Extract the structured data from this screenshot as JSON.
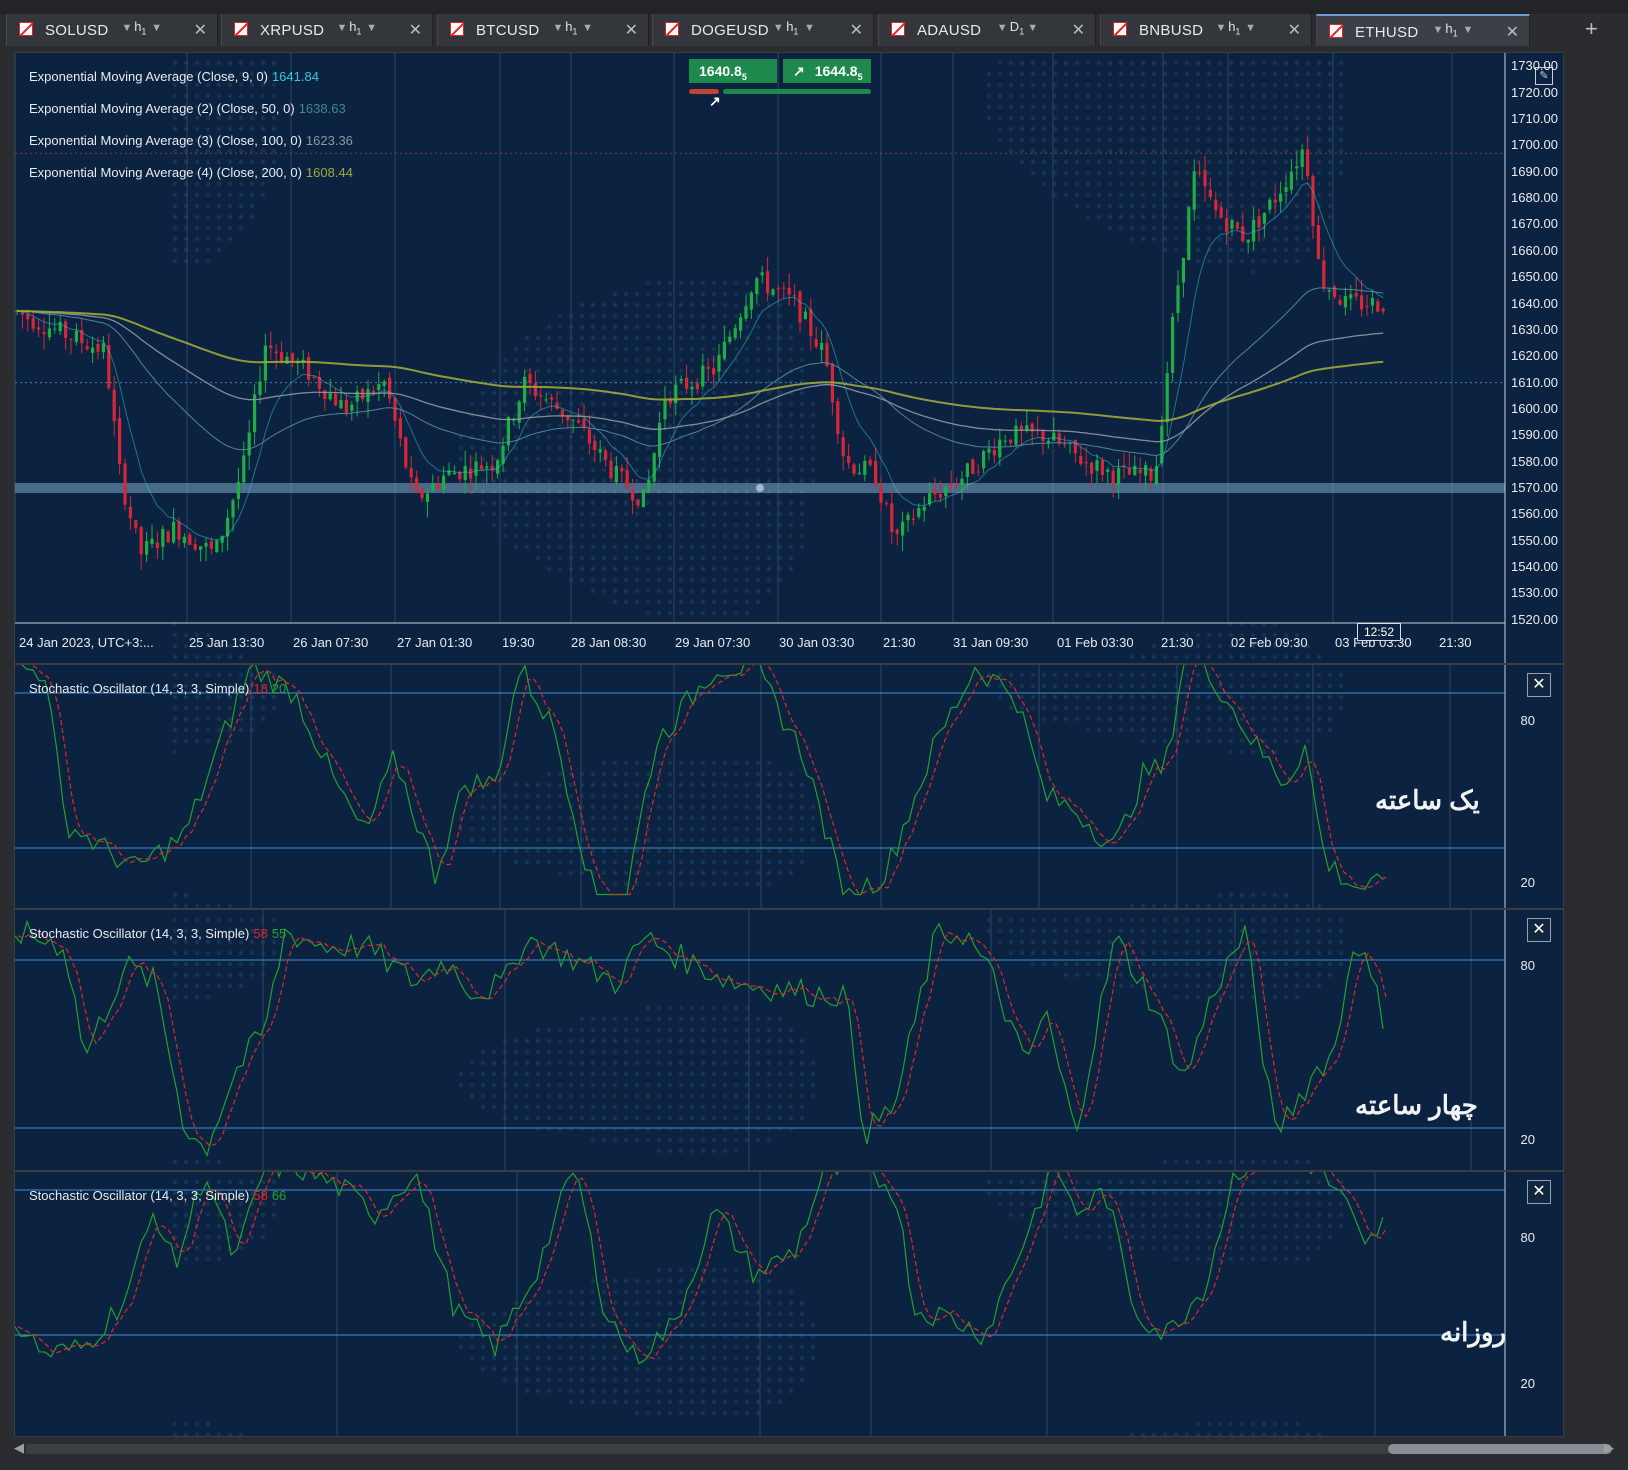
{
  "tabs": [
    {
      "symbol": "SOLUSD",
      "timeframe": "h",
      "sub": "1"
    },
    {
      "symbol": "XRPUSD",
      "timeframe": "h",
      "sub": "1"
    },
    {
      "symbol": "BTCUSD",
      "timeframe": "h",
      "sub": "1"
    },
    {
      "symbol": "DOGEUSD",
      "timeframe": "h",
      "sub": "1"
    },
    {
      "symbol": "ADAUSD",
      "timeframe": "D",
      "sub": "1"
    },
    {
      "symbol": "BNBUSD",
      "timeframe": "h",
      "sub": "1"
    },
    {
      "symbol": "ETHUSD",
      "timeframe": "h",
      "sub": "1",
      "active": true
    }
  ],
  "main_chart": {
    "indicators": [
      {
        "label": "Exponential Moving Average (Close, 9, 0)",
        "value": "1641.84",
        "color": "#35c7d8"
      },
      {
        "label": "Exponential Moving Average (2) (Close, 50, 0)",
        "value": "1638.63",
        "color": "#3a8a8f"
      },
      {
        "label": "Exponential Moving Average (3) (Close, 100, 0)",
        "value": "1623.36",
        "color": "#8e98a2"
      },
      {
        "label": "Exponential Moving Average (4) (Close, 200, 0)",
        "value": "1608.44",
        "color": "#a0a838"
      }
    ],
    "bid": "1640.8",
    "bid_sub": "5",
    "ask": "1644.8",
    "ask_sub": "5",
    "price_axis": [
      "1730.00",
      "1720.00",
      "1710.00",
      "1700.00",
      "1690.00",
      "1680.00",
      "1670.00",
      "1660.00",
      "1650.00",
      "1640.00",
      "1630.00",
      "1620.00",
      "1610.00",
      "1600.00",
      "1590.00",
      "1580.00",
      "1570.00",
      "1560.00",
      "1550.00",
      "1540.00",
      "1530.00",
      "1520.00"
    ],
    "marked_levels": {
      "upper": "1697.00",
      "middle": "1610.00",
      "lower": "1570.00"
    },
    "time_axis": [
      "24 Jan 2023, UTC+3:...",
      "25 Jan 13:30",
      "26 Jan 07:30",
      "27 Jan 01:30",
      "19:30",
      "28 Jan 08:30",
      "29 Jan 07:30",
      "30 Jan 03:30",
      "21:30",
      "31 Jan 09:30",
      "01 Feb 03:30",
      "21:30",
      "02 Feb 09:30",
      "03 Feb 03:30",
      "21:30"
    ],
    "clock": "12:52"
  },
  "oscillators": [
    {
      "title": "Stochastic Oscillator (14, 3, 3, Simple)",
      "k": "18",
      "d": "20",
      "level_high": "80",
      "level_low": "20",
      "timeframe_label": "یک ساعته"
    },
    {
      "title": "Stochastic Oscillator (14, 3, 3, Simple)",
      "k": "58",
      "d": "55",
      "level_high": "80",
      "level_low": "20",
      "timeframe_label": "چهار ساعته"
    },
    {
      "title": "Stochastic Oscillator (14, 3, 3, Simple)",
      "k": "58",
      "d": "66",
      "level_high": "80",
      "level_low": "20",
      "timeframe_label": "روزانه"
    }
  ],
  "chart_data": [
    {
      "type": "candlestick",
      "title": "ETHUSD h1",
      "ylim": [
        1515,
        1732
      ],
      "ema": [
        {
          "name": "EMA 9",
          "last": 1641.84
        },
        {
          "name": "EMA 50",
          "last": 1638.63
        },
        {
          "name": "EMA 100",
          "last": 1623.36
        },
        {
          "name": "EMA 200",
          "last": 1608.44
        }
      ]
    },
    {
      "type": "line",
      "title": "Stochastic Oscillator (14, 3, 3, Simple)",
      "ylim": [
        0,
        100
      ],
      "levels": [
        80,
        20
      ],
      "last_k": 18,
      "last_d": 20
    },
    {
      "type": "line",
      "title": "Stochastic Oscillator (14, 3, 3, Simple)",
      "ylim": [
        0,
        100
      ],
      "levels": [
        80,
        20
      ],
      "last_k": 58,
      "last_d": 55
    },
    {
      "type": "line",
      "title": "Stochastic Oscillator (14, 3, 3, Simple)",
      "ylim": [
        0,
        100
      ],
      "levels": [
        80,
        20
      ],
      "last_k": 58,
      "last_d": 66
    }
  ],
  "icons": {
    "close": "close-icon",
    "add_tab": "plus-icon",
    "dropdown": "chevron-down-icon",
    "edit": "pencil-icon"
  }
}
